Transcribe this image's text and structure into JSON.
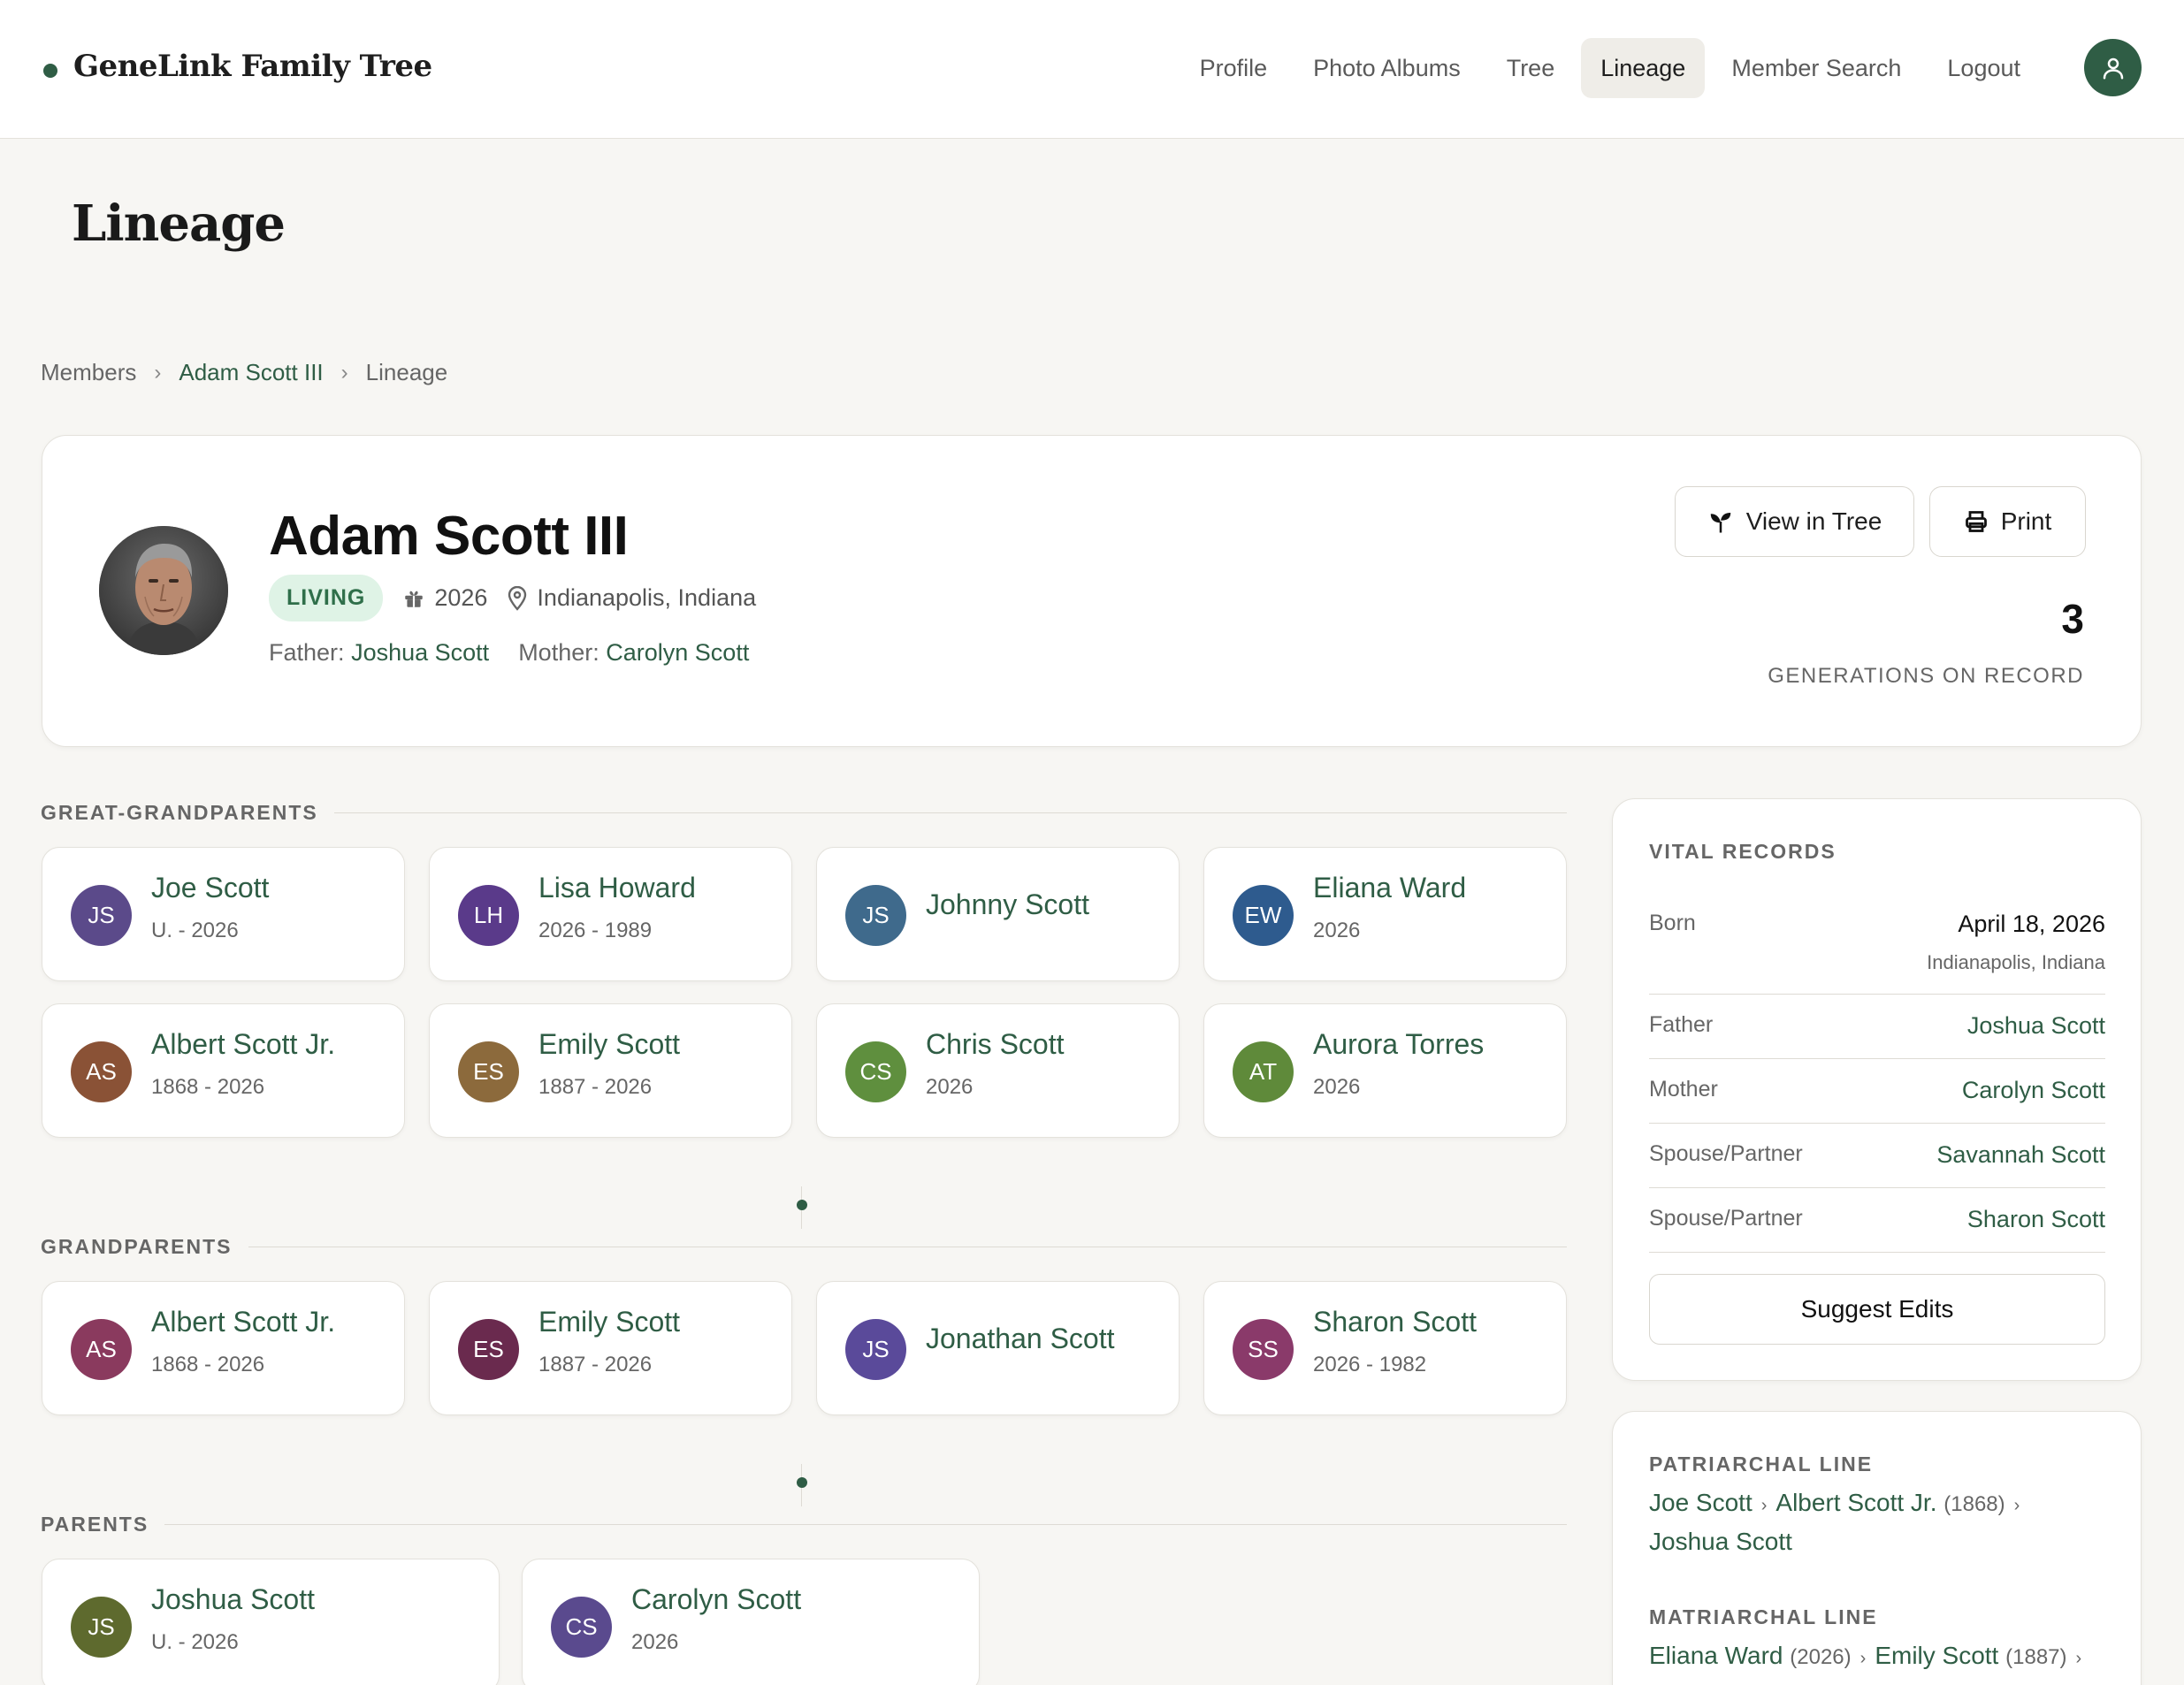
{
  "app": {
    "brand": "GeneLink Family Tree"
  },
  "nav": {
    "items": [
      "Profile",
      "Photo Albums",
      "Tree",
      "Lineage",
      "Member Search",
      "Logout"
    ],
    "active": "Lineage",
    "avatar_icon": "user-icon"
  },
  "page": {
    "title": "Lineage"
  },
  "breadcrumb": {
    "root": "Members",
    "member": "Adam Scott III",
    "current": "Lineage",
    "separator": "›"
  },
  "profile": {
    "name": "Adam Scott III",
    "status": "LIVING",
    "birth_year": "2026",
    "location": "Indianapolis, Indiana",
    "father_label": "Father:",
    "father": "Joshua Scott",
    "mother_label": "Mother:",
    "mother": "Carolyn Scott",
    "view_tree_label": "View in Tree",
    "print_label": "Print",
    "generations": "3",
    "generations_label": "GENERATIONS ON RECORD"
  },
  "sections": {
    "great_grandparents": "GREAT-GRANDPARENTS",
    "grandparents": "GRANDPARENTS",
    "parents": "PARENTS"
  },
  "great_grandparents": [
    {
      "initials": "JS",
      "name": "Joe Scott",
      "dates": "U. - 2026",
      "color": "#5b4a8a"
    },
    {
      "initials": "LH",
      "name": "Lisa Howard",
      "dates": "2026 - 1989",
      "color": "#5a3a8a"
    },
    {
      "initials": "JS",
      "name": "Johnny Scott",
      "dates": "",
      "color": "#3f6a8c"
    },
    {
      "initials": "EW",
      "name": "Eliana Ward",
      "dates": "2026",
      "color": "#2e5b8e"
    },
    {
      "initials": "AS",
      "name": "Albert Scott Jr.",
      "dates": "1868 - 2026",
      "color": "#8a5236"
    },
    {
      "initials": "ES",
      "name": "Emily Scott",
      "dates": "1887 - 2026",
      "color": "#8c6a3c"
    },
    {
      "initials": "CS",
      "name": "Chris Scott",
      "dates": "2026",
      "color": "#5f8f3e"
    },
    {
      "initials": "AT",
      "name": "Aurora Torres",
      "dates": "2026",
      "color": "#5f8a3a"
    }
  ],
  "grandparents": [
    {
      "initials": "AS",
      "name": "Albert Scott Jr.",
      "dates": "1868 - 2026",
      "color": "#8a3a5e"
    },
    {
      "initials": "ES",
      "name": "Emily Scott",
      "dates": "1887 - 2026",
      "color": "#6a2a4e"
    },
    {
      "initials": "JS",
      "name": "Jonathan Scott",
      "dates": "",
      "color": "#5a4a9a"
    },
    {
      "initials": "SS",
      "name": "Sharon Scott",
      "dates": "2026 - 1982",
      "color": "#8a3a6a"
    }
  ],
  "parents": [
    {
      "initials": "JS",
      "name": "Joshua Scott",
      "dates": "U. - 2026",
      "color": "#5e6a2e"
    },
    {
      "initials": "CS",
      "name": "Carolyn Scott",
      "dates": "2026",
      "color": "#5a4a8e"
    }
  ],
  "vital_records": {
    "title": "VITAL RECORDS",
    "rows": [
      {
        "key": "Born",
        "value": "April 18, 2026",
        "sub": "Indianapolis, Indiana"
      },
      {
        "key": "Father",
        "value": "Joshua Scott"
      },
      {
        "key": "Mother",
        "value": "Carolyn Scott"
      },
      {
        "key": "Spouse/Partner",
        "value": "Savannah Scott"
      },
      {
        "key": "Spouse/Partner",
        "value": "Sharon Scott"
      }
    ],
    "suggest_label": "Suggest Edits"
  },
  "lines": {
    "patriarchal_title": "PATRIARCHAL LINE",
    "patriarchal": [
      {
        "name": "Joe Scott",
        "year": ""
      },
      {
        "name": "Albert Scott Jr.",
        "year": "(1868)"
      },
      {
        "name": "Joshua Scott",
        "year": ""
      }
    ],
    "matriarchal_title": "MATRIARCHAL LINE",
    "matriarchal": [
      {
        "name": "Eliana Ward",
        "year": "(2026)"
      },
      {
        "name": "Emily Scott",
        "year": "(1887)"
      }
    ]
  },
  "colors": {
    "accent": "#2f5d45",
    "background": "#f7f6f3",
    "living_badge": "#dff3e6"
  }
}
